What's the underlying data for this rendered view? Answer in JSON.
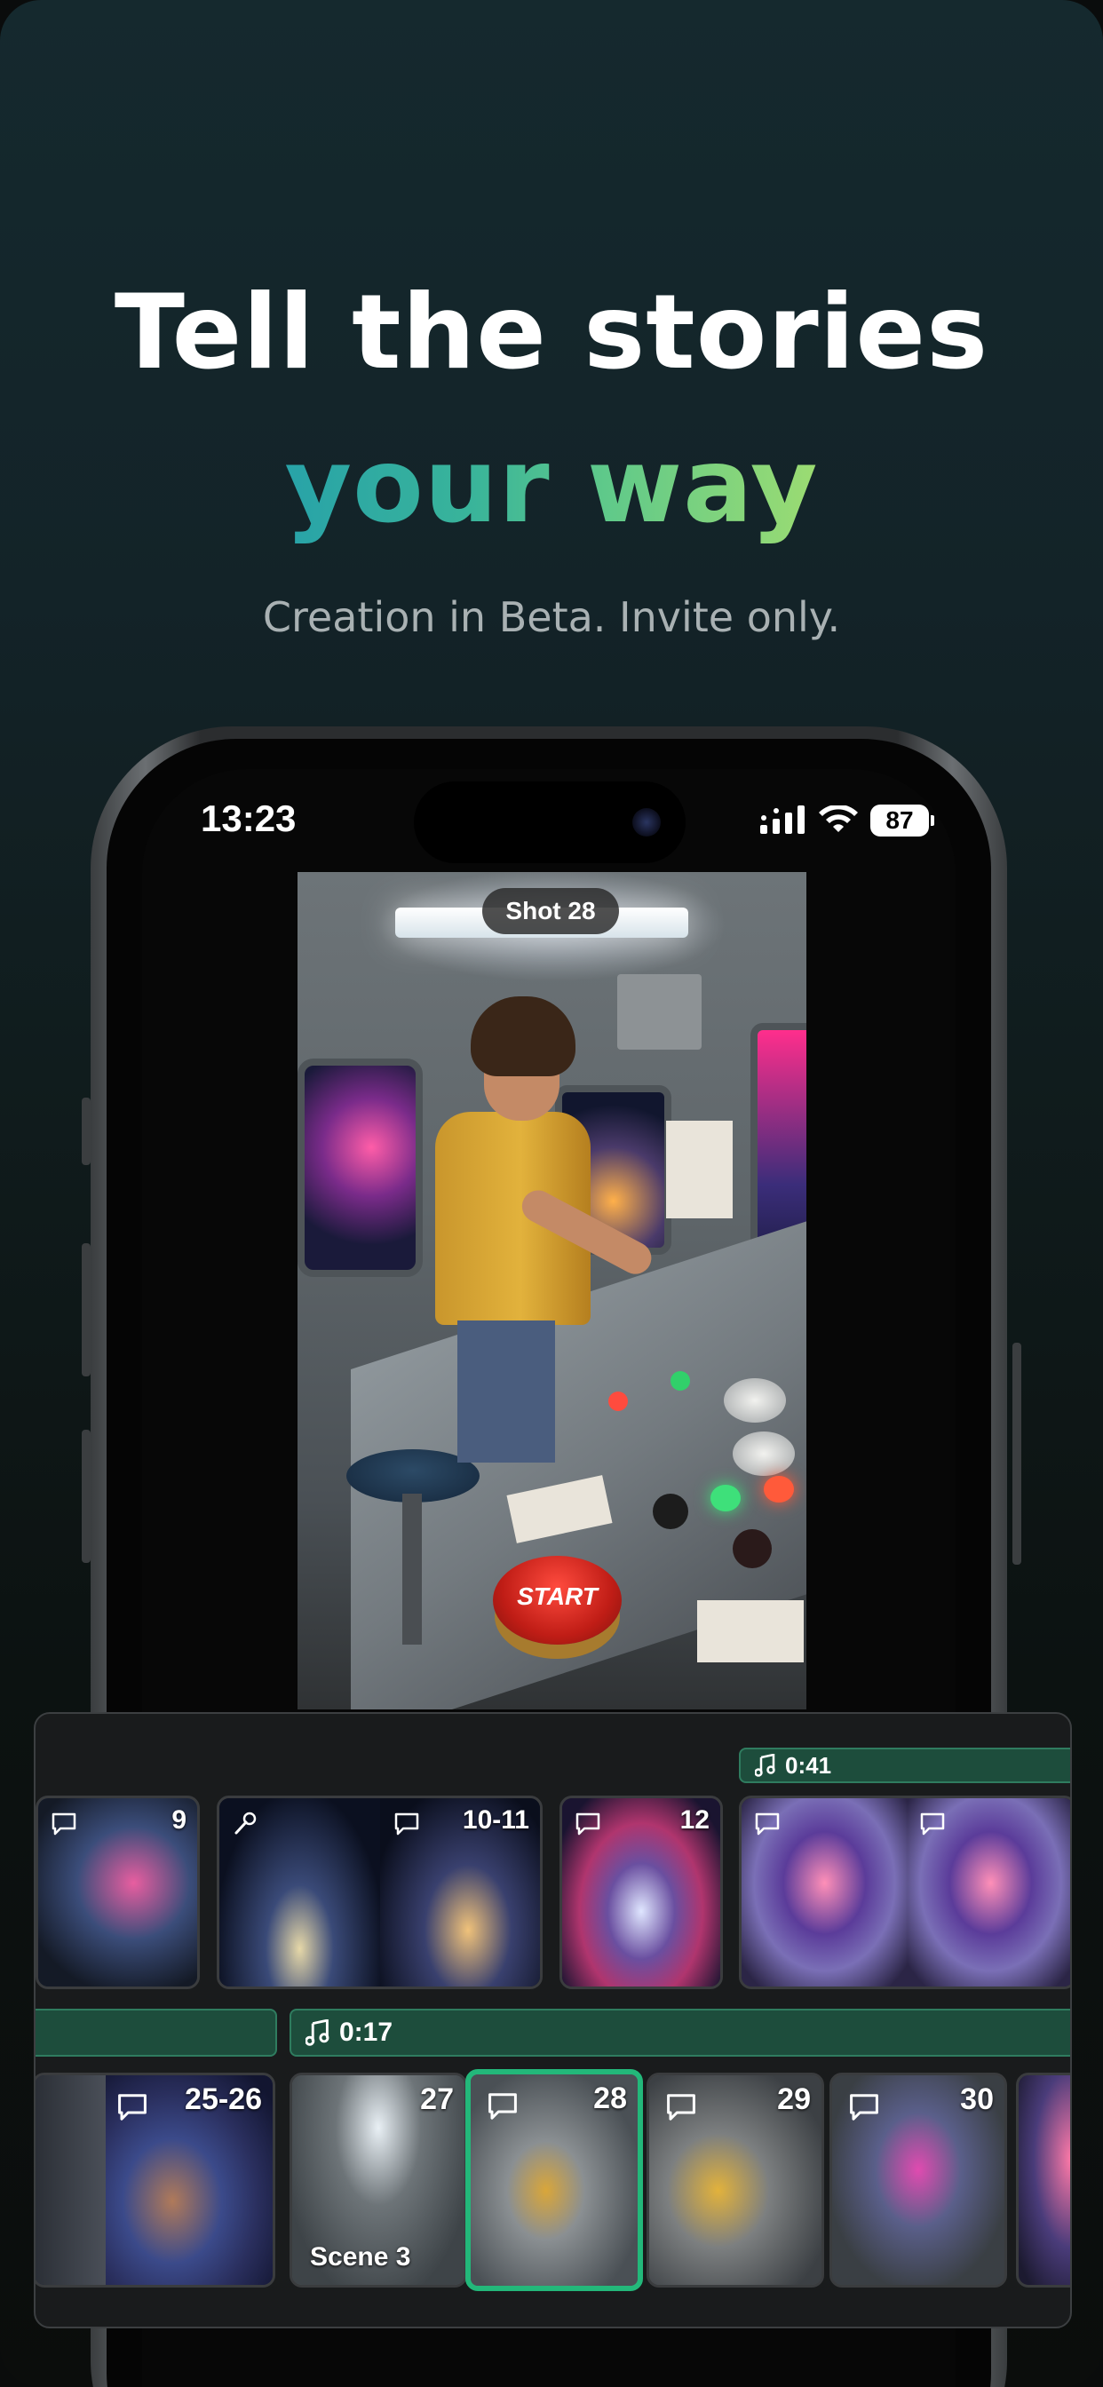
{
  "headline": {
    "line1": "Tell the stories",
    "line2": "your way",
    "subtitle": "Creation in Beta. Invite only."
  },
  "status_bar": {
    "time": "13:23",
    "battery": "87",
    "icons": [
      "signal-icon",
      "wifi-icon",
      "battery-icon"
    ]
  },
  "preview": {
    "shot_label": "Shot 28",
    "button_text": "START"
  },
  "colors": {
    "accent_green": "#23b87a",
    "audio_track": "#1d4d3c",
    "gradient_start": "#28a3a8",
    "gradient_end": "#9cdc72"
  },
  "timeline": {
    "row1_audio": "0:41",
    "row2_audio": "0:17",
    "row1_clips": [
      {
        "label": "9",
        "icons": [
          "comment-icon"
        ]
      },
      {
        "label": "10-11",
        "icons": [
          "microphone-icon",
          "comment-icon"
        ]
      },
      {
        "label": "12",
        "icons": [
          "comment-icon"
        ]
      },
      {
        "label": "",
        "icons": [
          "comment-icon",
          "comment-icon"
        ]
      }
    ],
    "row2_clips": [
      {
        "label": "25-26",
        "icons": [
          "comment-icon"
        ]
      },
      {
        "label": "27",
        "icons": [],
        "scene": "Scene 3"
      },
      {
        "label": "28",
        "icons": [
          "comment-icon"
        ],
        "selected": true
      },
      {
        "label": "29",
        "icons": [
          "comment-icon"
        ]
      },
      {
        "label": "30",
        "icons": [
          "comment-icon"
        ]
      }
    ]
  }
}
